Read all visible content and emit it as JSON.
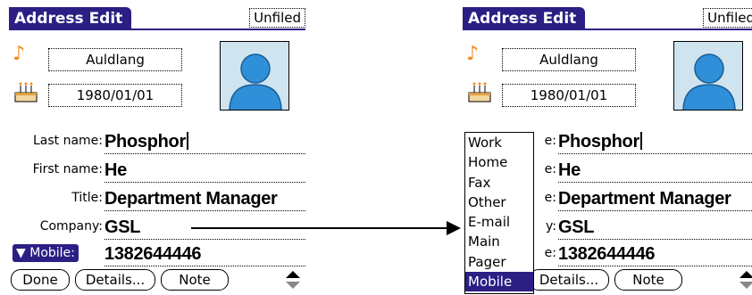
{
  "screens": {
    "left": {
      "title": "Address Edit",
      "category": "Unfiled",
      "ringtone": "Auldlang",
      "birthday": "1980/01/01",
      "fields": {
        "last_name_label": "Last name:",
        "last_name": "Phosphor",
        "first_name_label": "First name:",
        "first_name": "He",
        "title_label": "Title:",
        "title_value": "Department Manager",
        "company_label": "Company:",
        "company": "GSL",
        "phone_label": "Mobile:",
        "phone": "1382644446"
      },
      "buttons": {
        "done": "Done",
        "details": "Details...",
        "note": "Note"
      }
    },
    "right": {
      "title": "Address Edit",
      "category": "Unfiled",
      "ringtone": "Auldlang",
      "birthday": "1980/01/01",
      "fields": {
        "last_name_label": "e:",
        "last_name": "Phosphor",
        "first_name_label": "e:",
        "first_name": "He",
        "title_label": "e:",
        "title_value": "Department Manager",
        "company_label": "y:",
        "company": "GSL",
        "phone_label": "e:",
        "phone": "1382644446"
      },
      "buttons": {
        "details": "Details...",
        "note": "Note"
      },
      "phone_type_menu": {
        "items": [
          "Work",
          "Home",
          "Fax",
          "Other",
          "E-mail",
          "Main",
          "Pager",
          "Mobile"
        ],
        "selected": "Mobile"
      }
    }
  },
  "colors": {
    "accent": "#2b1f84",
    "ringtone_icon": "#f08c1c",
    "photo_bg": "#cfe4ef"
  },
  "icons": [
    "ringtone-note-icon",
    "birthday-cake-icon",
    "contact-photo-icon",
    "dropdown-triangle-icon",
    "scroll-arrows-icon"
  ]
}
